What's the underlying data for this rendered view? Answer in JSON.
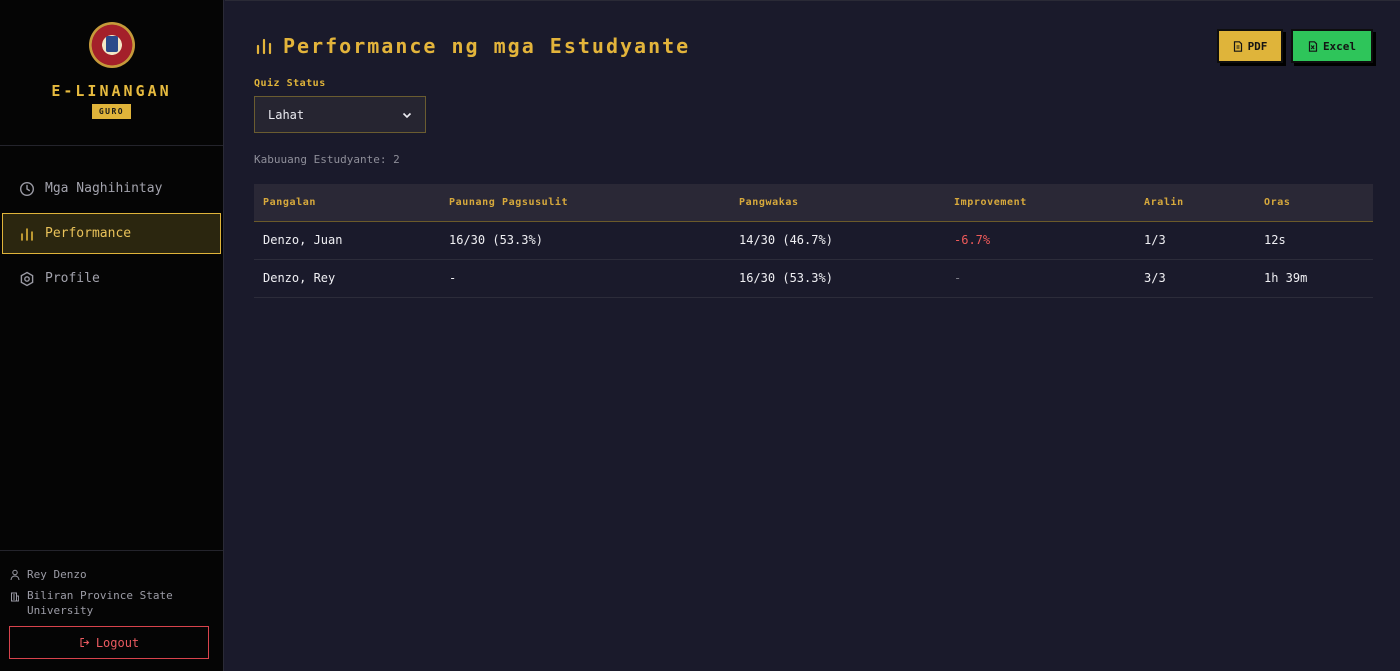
{
  "brand": {
    "title": "E-LINANGAN",
    "role": "GURO"
  },
  "nav": {
    "items": [
      {
        "label": "Mga Naghihintay",
        "icon": "clock-icon",
        "active": false
      },
      {
        "label": "Performance",
        "icon": "bar-chart-icon",
        "active": true
      },
      {
        "label": "Profile",
        "icon": "hexagon-gear-icon",
        "active": false
      }
    ]
  },
  "user": {
    "name": "Rey Denzo",
    "school": "Biliran Province State University"
  },
  "logout_label": "Logout",
  "page": {
    "title": "Performance ng mga Estudyante"
  },
  "export": {
    "pdf_label": "PDF",
    "excel_label": "Excel"
  },
  "filter": {
    "label": "Quiz Status",
    "selected": "Lahat"
  },
  "summary": {
    "count_text": "Kabuuang Estudyante: 2"
  },
  "table": {
    "headers": [
      "Pangalan",
      "Paunang Pagsusulit",
      "Pangwakas",
      "Improvement",
      "Aralin",
      "Oras"
    ],
    "rows": [
      {
        "name": "Denzo, Juan",
        "pre": "16/30 (53.3%)",
        "post": "14/30 (46.7%)",
        "improvement": "-6.7%",
        "lessons": "1/3",
        "time": "12s"
      },
      {
        "name": "Denzo, Rey",
        "pre": "-",
        "post": "16/30 (53.3%)",
        "improvement": "-",
        "lessons": "3/3",
        "time": "1h 39m"
      }
    ]
  },
  "colors": {
    "accent": "#e0b43a",
    "negative": "#ef5a5a",
    "excel": "#2ec55a",
    "danger": "#d8434c"
  }
}
